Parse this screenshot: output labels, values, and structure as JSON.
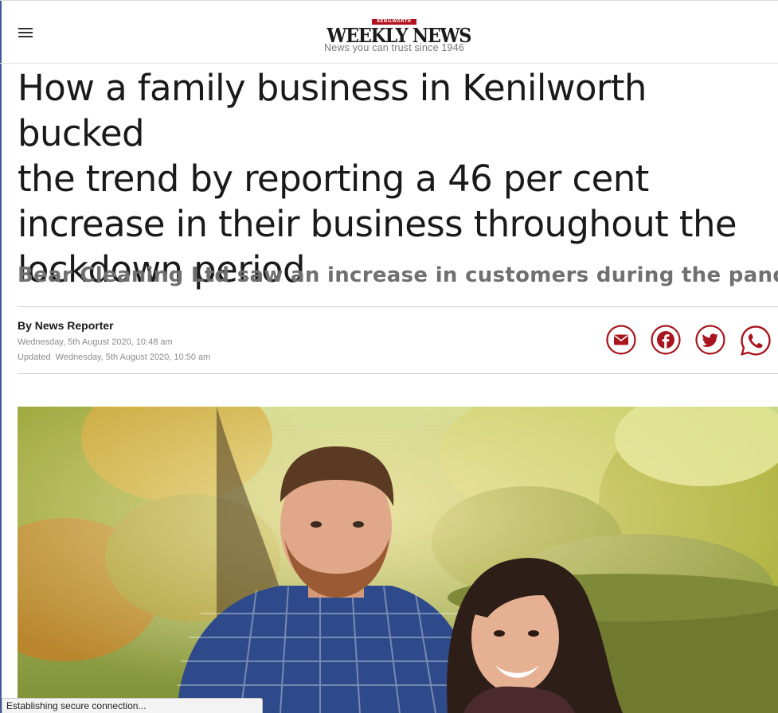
{
  "header": {
    "logo_kicker": "KENILWORTH",
    "logo_name": "WEEKLY NEWS",
    "tagline": "News you can trust since 1946",
    "menu_icon": "hamburger-menu-icon"
  },
  "article": {
    "headline": "How a family business in Kenilworth bucked\nthe trend by reporting a 46 per cent\nincrease in their business throughout the\nlockdown period",
    "subheadline": "Bear Cleaning Ltd saw an increase in customers during the pandemic",
    "byline": "By News Reporter",
    "published": "Wednesday, 5th August 2020, 10:48 am",
    "updated_label": "Updated",
    "updated": "Wednesday, 5th August 2020, 10:50 am"
  },
  "share": {
    "icons": [
      "email-icon",
      "facebook-icon",
      "twitter-icon",
      "whatsapp-icon"
    ]
  },
  "status_bar": {
    "text": "Establishing secure connection..."
  },
  "colors": {
    "brand_red": "#b3111d",
    "share_red": "#a8141e",
    "text": "#1a1a1a",
    "muted": "#707070"
  }
}
